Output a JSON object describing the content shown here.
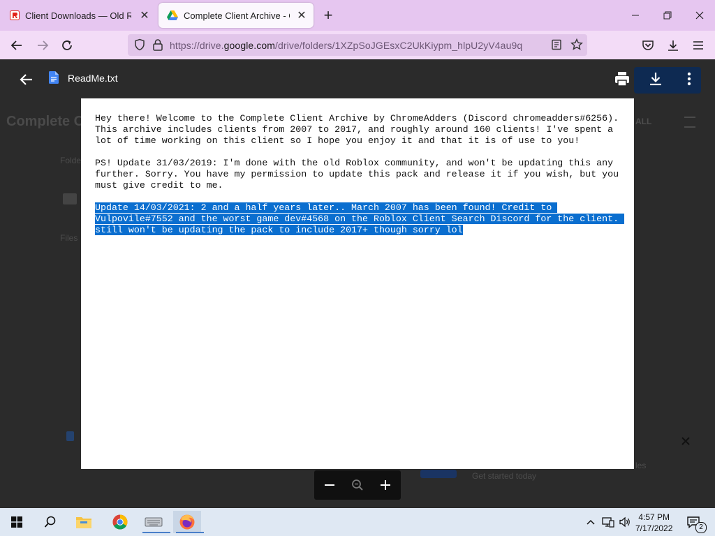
{
  "browser": {
    "tabs": [
      {
        "title": "Client Downloads — Old ROBLOX",
        "active": false
      },
      {
        "title": "Complete Client Archive - Google Drive",
        "active": true
      }
    ],
    "url_prefix": "https://drive.",
    "url_domain": "google.com",
    "url_path": "/drive/folders/1XZpSoJGEsxC2UkKiypm_hlpU2yV4au9q"
  },
  "background_page": {
    "title_fragment": "Complete C",
    "label_folders": "Folde",
    "label_files": "Files",
    "button_fragment": "ALL",
    "notice_fragment": "Get started today",
    "notice_fragment2": "les"
  },
  "viewer": {
    "filename": "ReadMe.txt",
    "paragraphs": [
      "Hey there! Welcome to the Complete Client Archive by ChromeAdders (Discord chromeadders#6256).\nThis archive includes clients from 2007 to 2017, and roughly around 160 clients! I've spent a\nlot of time working on this client so I hope you enjoy it and that it is of use to you!",
      "PS! Update 31/03/2019: I'm done with the old Roblox community, and won't be updating this any\nfurther. Sorry. You have my permission to update this pack and release it if you wish, but you\nmust give credit to me."
    ],
    "selected_lines": [
      "Update 14/03/2021: 2 and a half years later.. March 2007 has been found! Credit to ",
      "Vulpovile#7552 and the worst game dev#4568 on the Roblox Client Search Discord for the client. ",
      "still won't be updating the pack to include 2017+ though sorry lol"
    ]
  },
  "taskbar": {
    "time": "4:57 PM",
    "date": "7/17/2022",
    "notification_count": "2"
  },
  "colors": {
    "tabstrip": "#e6c6f0",
    "selection": "#0a6ecf",
    "taskbar": "#dfe8f3"
  }
}
